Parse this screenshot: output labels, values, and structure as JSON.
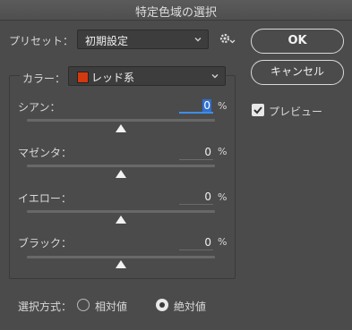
{
  "window": {
    "title": "特定色域の選択"
  },
  "preset": {
    "label": "プリセット：",
    "value": "初期設定"
  },
  "buttons": {
    "ok": "OK",
    "cancel": "キャンセル"
  },
  "preview": {
    "label": "プレビュー",
    "checked": true
  },
  "color": {
    "label": "カラー：",
    "value": "レッド系",
    "swatch": "#d13a0f"
  },
  "sliders": [
    {
      "label": "シアン：",
      "value": "0",
      "unit": "%"
    },
    {
      "label": "マゼンタ：",
      "value": "0",
      "unit": "%"
    },
    {
      "label": "イエロー：",
      "value": "0",
      "unit": "%"
    },
    {
      "label": "ブラック：",
      "value": "0",
      "unit": "%"
    }
  ],
  "method": {
    "label": "選択方式：",
    "relative": "相対値",
    "absolute": "絶対値",
    "selected": "absolute"
  }
}
